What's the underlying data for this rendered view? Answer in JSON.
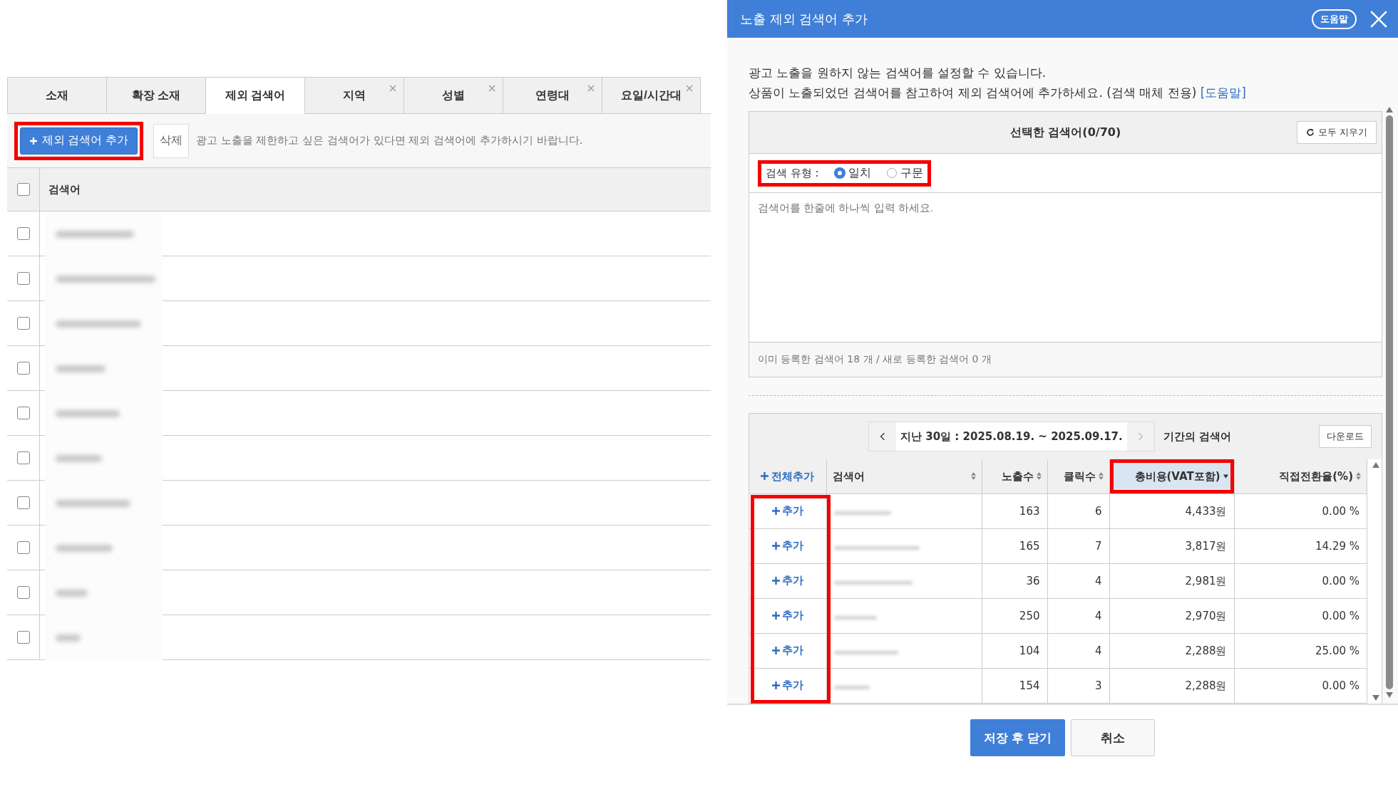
{
  "left_panel": {
    "tabs": [
      {
        "label": "소재",
        "selected": false,
        "closable": false
      },
      {
        "label": "확장 소재",
        "selected": false,
        "closable": false
      },
      {
        "label": "제외 검색어",
        "selected": true,
        "closable": false
      },
      {
        "label": "지역",
        "selected": false,
        "closable": true
      },
      {
        "label": "성별",
        "selected": false,
        "closable": true
      },
      {
        "label": "연령대",
        "selected": false,
        "closable": true
      },
      {
        "label": "요일/시간대",
        "selected": false,
        "closable": true
      }
    ],
    "toolbar": {
      "add_button": {
        "label": "제외 검색어 추가",
        "highlighted": true
      },
      "delete_button": "삭제",
      "hint": "광고 노출을 제한하고 싶은 검색어가 있다면 제외 검색어에 추가하시기 바랍니다."
    },
    "table": {
      "header_checked": false,
      "columns": [
        "검색어"
      ],
      "rows": [
        {
          "checked": false
        },
        {
          "checked": false
        },
        {
          "checked": false
        },
        {
          "checked": false
        },
        {
          "checked": false
        },
        {
          "checked": false
        },
        {
          "checked": false
        },
        {
          "checked": false
        },
        {
          "checked": false
        },
        {
          "checked": false
        }
      ]
    }
  },
  "dialog": {
    "title": "노출 제외 검색어 추가",
    "help_badge": "도움말",
    "description": [
      "광고 노출을 원하지 않는 검색어를 설정할 수 있습니다.",
      "상품이 노출되었던 검색어를 참고하여 제외 검색어에 추가하세요. (검색 매체 전용)"
    ],
    "help_link": "[도움말]",
    "selected_panel": {
      "title": "선택한 검색어(0/70)",
      "clear_button": "모두 지우기",
      "search_type": {
        "label": "검색 유형 :",
        "highlighted": true,
        "options": [
          {
            "label": "일치",
            "selected": true
          },
          {
            "label": "구문",
            "selected": false
          }
        ]
      },
      "placeholder": "검색어를 한줄에 하나씩 입력 하세요.",
      "summary": "이미 등록한 검색어 18 개 / 새로 등록한 검색어 0 개"
    },
    "keyword_table": {
      "period": "지난 30일 : 2025.08.19. ~ 2025.09.17.",
      "period_suffix": "기간의 검색어",
      "next_disabled": true,
      "download_button": "다운로드",
      "add_column_highlighted": true,
      "columns": [
        {
          "label": "전체추가",
          "kind": "add_all",
          "sortable": false,
          "sorted_desc": false,
          "highlighted": false
        },
        {
          "label": "검색어",
          "kind": "text",
          "sortable": true,
          "sorted_desc": false,
          "highlighted": false
        },
        {
          "label": "노출수",
          "kind": "text",
          "sortable": true,
          "sorted_desc": false,
          "highlighted": false
        },
        {
          "label": "클릭수",
          "kind": "text",
          "sortable": true,
          "sorted_desc": false,
          "highlighted": false
        },
        {
          "label": "총비용(VAT포함)",
          "kind": "text",
          "sortable": true,
          "sorted_desc": true,
          "highlighted": true
        },
        {
          "label": "직접전환율(%)",
          "kind": "text",
          "sortable": true,
          "sorted_desc": false,
          "highlighted": false
        }
      ],
      "rows": [
        {
          "add": "추가",
          "impressions": "163",
          "clicks": "6",
          "cost": "4,433원",
          "conversion": "0.00 %"
        },
        {
          "add": "추가",
          "impressions": "165",
          "clicks": "7",
          "cost": "3,817원",
          "conversion": "14.29 %"
        },
        {
          "add": "추가",
          "impressions": "36",
          "clicks": "4",
          "cost": "2,981원",
          "conversion": "0.00 %"
        },
        {
          "add": "추가",
          "impressions": "250",
          "clicks": "4",
          "cost": "2,970원",
          "conversion": "0.00 %"
        },
        {
          "add": "추가",
          "impressions": "104",
          "clicks": "4",
          "cost": "2,288원",
          "conversion": "25.00 %"
        },
        {
          "add": "추가",
          "impressions": "154",
          "clicks": "3",
          "cost": "2,288원",
          "conversion": "0.00 %"
        }
      ]
    },
    "buttons": [
      {
        "label": "저장 후 닫기",
        "kind": "primary"
      },
      {
        "label": "취소",
        "kind": "secondary"
      }
    ]
  }
}
